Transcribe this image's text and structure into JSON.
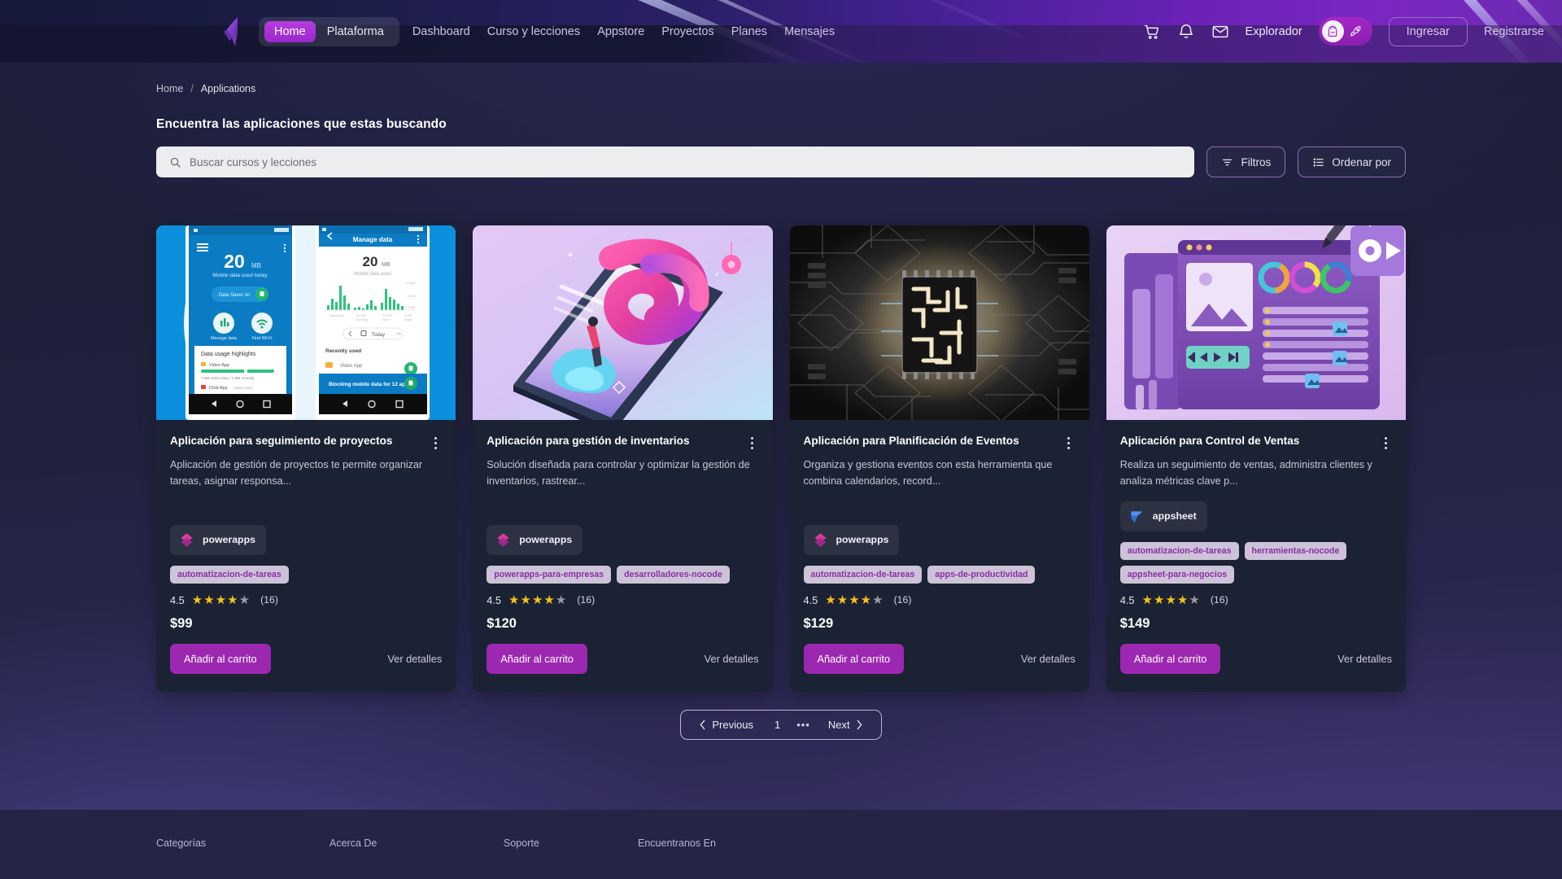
{
  "header": {
    "logo_icon": "brand-logo-icon",
    "segmented": {
      "items": [
        {
          "label": "Home",
          "active": true
        },
        {
          "label": "Plataforma",
          "active": false
        }
      ]
    },
    "nav": [
      {
        "label": "Dashboard"
      },
      {
        "label": "Curso y lecciones"
      },
      {
        "label": "Appstore"
      },
      {
        "label": "Proyectos"
      },
      {
        "label": "Planes"
      },
      {
        "label": "Mensajes"
      }
    ],
    "icons": [
      {
        "name": "cart-icon"
      },
      {
        "name": "bell-icon"
      },
      {
        "name": "mail-icon"
      }
    ],
    "explorador_label": "Explorador",
    "mode_toggle": {
      "active_icon": "backpack-icon",
      "inactive_icon": "rocket-icon"
    },
    "login_label": "Ingresar",
    "register_label": "Registrarse",
    "accent": "#9c28b1"
  },
  "breadcrumb": {
    "home": "Home",
    "separator": "/",
    "current": "Applications"
  },
  "page_title": "Encuentra las aplicaciones que estas buscando",
  "search": {
    "placeholder": "Buscar cursos y lecciones",
    "value": "",
    "icon": "search-icon"
  },
  "controls": {
    "filters_label": "Filtros",
    "filters_icon": "filter-icon",
    "sort_label": "Ordenar por",
    "sort_icon": "sort-list-icon"
  },
  "cards": [
    {
      "title": "Aplicación para seguimiento de proyectos",
      "description": "Aplicación de gestión de proyectos te permite organizar tareas, asignar responsa...",
      "thumb": "datally-mobile-screens",
      "vendor": {
        "name": "powerapps",
        "icon": "powerapps-icon"
      },
      "tags": [
        "automatizacion-de-tareas"
      ],
      "rating": {
        "value": "4.5",
        "stars_filled": 4,
        "count": "(16)"
      },
      "price": "$99",
      "cart_label": "Añadir al carrito",
      "details_label": "Ver detalles",
      "menu_icon": "kebab-menu-icon"
    },
    {
      "title": "Aplicación para gestión de inventarios",
      "description": "Solución diseñada para controlar y optimizar la gestión de inventarios, rastrear...",
      "thumb": "isometric-phone-illustration",
      "vendor": {
        "name": "powerapps",
        "icon": "powerapps-icon"
      },
      "tags": [
        "powerapps-para-empresas",
        "desarrolladores-nocode"
      ],
      "rating": {
        "value": "4.5",
        "stars_filled": 4,
        "count": "(16)"
      },
      "price": "$120",
      "cart_label": "Añadir al carrito",
      "details_label": "Ver detalles",
      "menu_icon": "kebab-menu-icon"
    },
    {
      "title": "Aplicación para Planificación de Eventos",
      "description": "Organiza y gestiona eventos con esta herramienta que combina calendarios, record...",
      "thumb": "glowing-circuit-chip",
      "vendor": {
        "name": "powerapps",
        "icon": "powerapps-icon"
      },
      "tags": [
        "automatizacion-de-tareas",
        "apps-de-productividad"
      ],
      "rating": {
        "value": "4.5",
        "stars_filled": 4,
        "count": "(16)"
      },
      "price": "$129",
      "cart_label": "Añadir al carrito",
      "details_label": "Ver detalles",
      "menu_icon": "kebab-menu-icon"
    },
    {
      "title": "Aplicación para Control de Ventas",
      "description": "Realiza un seguimiento de ventas, administra clientes y analiza métricas clave p...",
      "thumb": "purple-editor-illustration",
      "vendor": {
        "name": "appsheet",
        "icon": "appsheet-icon"
      },
      "tags": [
        "automatizacion-de-tareas",
        "herramientas-nocode",
        "appsheet-para-negocios"
      ],
      "rating": {
        "value": "4.5",
        "stars_filled": 4,
        "count": "(16)"
      },
      "price": "$149",
      "cart_label": "Añadir al carrito",
      "details_label": "Ver detalles",
      "menu_icon": "kebab-menu-icon"
    }
  ],
  "pagination": {
    "previous_label": "Previous",
    "page": "1",
    "ellipsis": "•••",
    "next_label": "Next",
    "prev_icon": "chevron-left-icon",
    "next_icon": "chevron-right-icon"
  },
  "footer": {
    "columns": [
      {
        "label": "Categorías"
      },
      {
        "label": "Acerca De"
      },
      {
        "label": "Soporte"
      },
      {
        "label": "Encuentranos En"
      }
    ]
  }
}
